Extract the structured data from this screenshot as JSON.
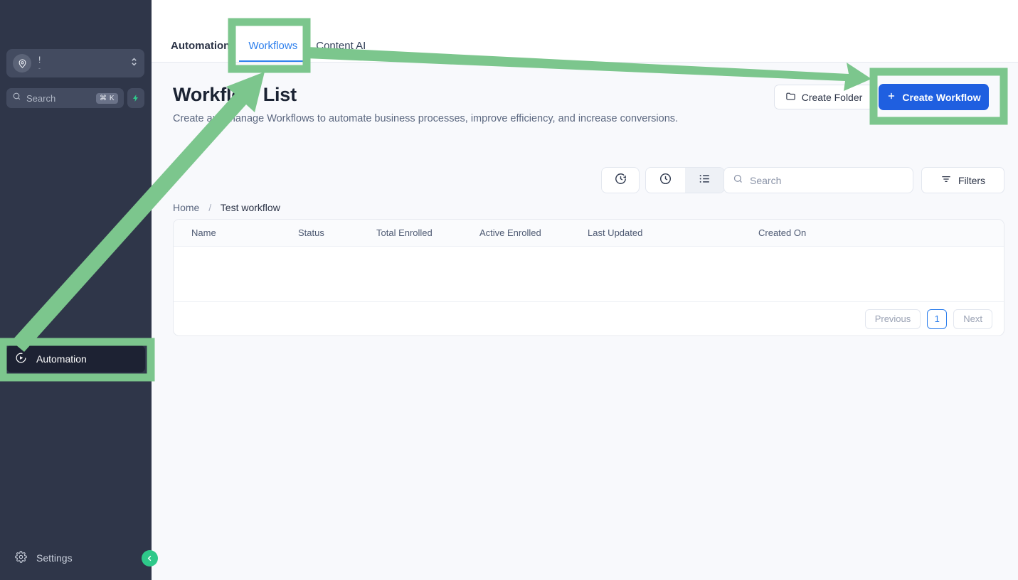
{
  "colors": {
    "sidebar_bg": "#2f3649",
    "accent_blue": "#1f5fe0",
    "tab_active": "#2f80ed",
    "annotation_green": "#7cc68d",
    "collapse_green": "#2ec98a",
    "page_bg": "#f8f9fc"
  },
  "sidebar": {
    "location_switcher": {
      "icon": "location-pin-icon",
      "value": "!",
      "subvalue": "-",
      "chevron_icon": "chevron-up-down-icon"
    },
    "search": {
      "icon": "search-icon",
      "placeholder": "Search",
      "shortcut": "⌘ K"
    },
    "spark_button": {
      "icon": "lightning-bolt-icon"
    },
    "items": [
      {
        "icon": "play-circle-icon",
        "label": "Automation",
        "active": true
      },
      {
        "icon": "gear-icon",
        "label": "Settings",
        "active": false
      }
    ],
    "collapse_button": {
      "icon": "chevron-left-icon"
    }
  },
  "topbar": {
    "tabs": [
      {
        "label": "Automation",
        "state": "primary"
      },
      {
        "label": "Workflows",
        "state": "active"
      },
      {
        "label": "Content AI",
        "state": "normal"
      }
    ]
  },
  "header": {
    "title": "Workflow List",
    "description": "Create and manage Workflows to automate business processes, improve efficiency, and increase conversions.",
    "create_folder": {
      "label": "Create Folder",
      "icon": "folder-icon"
    },
    "create_workflow": {
      "label": "Create Workflow",
      "icon": "plus-icon"
    }
  },
  "toolbar": {
    "view_single_icon": "clock-arrow-icon",
    "view_clock_icon": "clock-icon",
    "view_list_icon": "list-icon",
    "search": {
      "icon": "search-icon",
      "placeholder": "Search",
      "value": ""
    },
    "filters": {
      "label": "Filters",
      "icon": "filter-icon"
    }
  },
  "breadcrumb": {
    "home": "Home",
    "separator": "/",
    "current": "Test workflow"
  },
  "table": {
    "columns": [
      "Name",
      "Status",
      "Total Enrolled",
      "Active Enrolled",
      "Last Updated",
      "Created On"
    ],
    "rows": [],
    "pagination": {
      "previous": "Previous",
      "page": "1",
      "next": "Next"
    }
  },
  "annotations": {
    "box_workflows_tab": "highlight-workflows-tab",
    "box_create_workflow": "highlight-create-workflow-button",
    "box_automation_nav": "highlight-automation-nav",
    "arrow_to_tab": "arrow-pointing-to-workflows-tab",
    "arrow_to_button": "arrow-pointing-to-create-workflow-button"
  }
}
